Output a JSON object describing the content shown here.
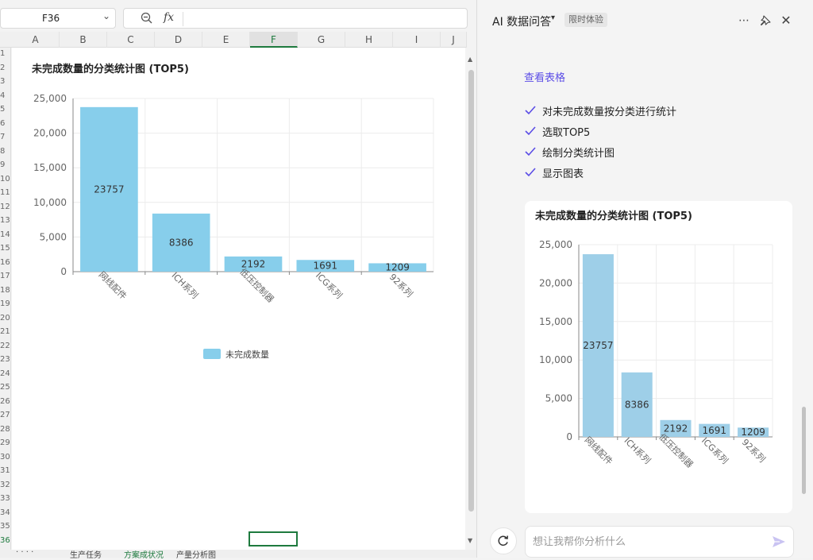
{
  "sheet": {
    "name_box": "F36",
    "fx_label": "fx",
    "columns": [
      "A",
      "B",
      "C",
      "D",
      "E",
      "F",
      "G",
      "H",
      "I",
      "J"
    ],
    "selected_column": "F",
    "rows": [
      "1",
      "2",
      "3",
      "4",
      "5",
      "6",
      "7",
      "8",
      "9",
      "10",
      "11",
      "12",
      "13",
      "14",
      "15",
      "16",
      "17",
      "18",
      "19",
      "20",
      "21",
      "22",
      "23",
      "24",
      "25",
      "26",
      "27",
      "28",
      "29",
      "30",
      "31",
      "32",
      "33",
      "34",
      "35",
      "36"
    ],
    "selected_row": "36",
    "tabs": [
      "·  ·  ·  ·",
      "生产任务",
      "方案成状况",
      "产量分析图"
    ]
  },
  "ai": {
    "title": "AI 数据问答",
    "badge": "限时体验",
    "view_table_link": "查看表格",
    "steps": [
      "对未完成数量按分类进行统计",
      "选取TOP5",
      "绘制分类统计图",
      "显示图表"
    ],
    "input_placeholder": "想让我帮你分析什么"
  },
  "colors": {
    "bar1": "#87ceeb",
    "bar2": "#9ecfe8",
    "accent": "#5b4de6",
    "sheet_select": "#1e7a3e"
  },
  "icons": [
    "chevron-down-icon",
    "zoom-icon",
    "more-icon",
    "pin-icon",
    "close-icon",
    "check-icon",
    "refresh-icon",
    "send-icon"
  ],
  "chart_data": [
    {
      "type": "bar",
      "title": "未完成数量的分类统计图 (TOP5)",
      "categories": [
        "网线配件",
        "ICH系列",
        "低压控制器",
        "ICG系列",
        "92系列"
      ],
      "series": [
        {
          "name": "未完成数量",
          "values": [
            23757,
            8386,
            2192,
            1691,
            1209
          ]
        }
      ],
      "yticks": [
        "0",
        "5,000",
        "10,000",
        "15,000",
        "20,000",
        "25,000"
      ],
      "ylim": [
        0,
        25000
      ],
      "grid": true,
      "legend": "bottom-center"
    },
    {
      "type": "bar",
      "title": "未完成数量的分类统计图 (TOP5)",
      "categories": [
        "网线配件",
        "ICH系列",
        "低压控制器",
        "ICG系列",
        "92系列"
      ],
      "series": [
        {
          "values": [
            23757,
            8386,
            2192,
            1691,
            1209
          ]
        }
      ],
      "yticks": [
        "0",
        "5,000",
        "10,000",
        "15,000",
        "20,000",
        "25,000"
      ],
      "ylim": [
        0,
        25000
      ],
      "grid": true
    }
  ]
}
